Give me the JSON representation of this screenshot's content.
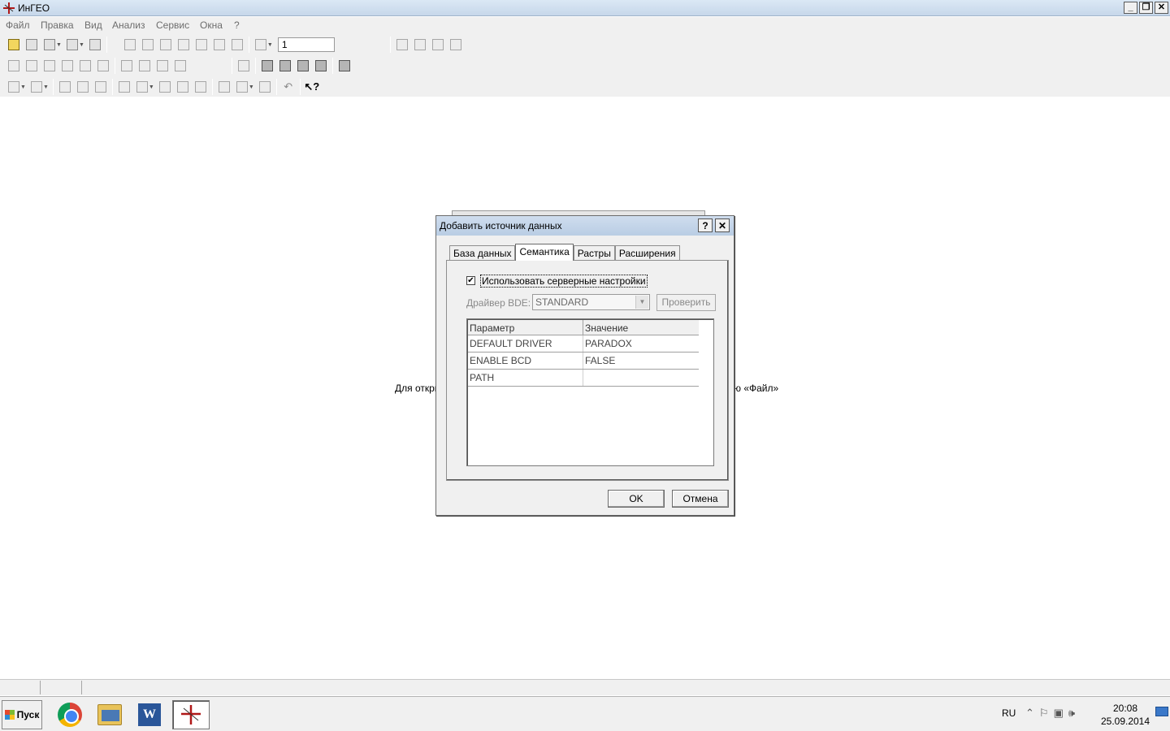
{
  "window": {
    "title": "ИнГЕО"
  },
  "menu": [
    "Файл",
    "Правка",
    "Вид",
    "Анализ",
    "Сервис",
    "Окна",
    "?"
  ],
  "toolbar": {
    "zoom_value": "1"
  },
  "main": {
    "hint_left": "Для откры",
    "hint_right": "ю «Файл»"
  },
  "dialog": {
    "title": "Добавить источник данных",
    "help_label": "?",
    "close_label": "✕",
    "tabs": [
      "База данных",
      "Семантика",
      "Растры",
      "Расширения"
    ],
    "active_tab": "Семантика",
    "use_server_settings": {
      "label": "Использовать серверные настройки",
      "checked": true,
      "mark": "✔"
    },
    "bde_driver": {
      "label": "Драйвер BDE:",
      "value": "STANDARD"
    },
    "check_button": "Проверить",
    "grid": {
      "headers": [
        "Параметр",
        "Значение"
      ],
      "rows": [
        [
          "DEFAULT DRIVER",
          "PARADOX"
        ],
        [
          "ENABLE BCD",
          "FALSE"
        ],
        [
          "PATH",
          ""
        ]
      ]
    },
    "ok_label": "OK",
    "cancel_label": "Отмена"
  },
  "taskbar": {
    "start_label": "Пуск",
    "language": "RU",
    "time": "20:08",
    "date": "25.09.2014",
    "apps": [
      "chrome-icon",
      "file-explorer-icon",
      "word-icon",
      "ingeo-icon"
    ]
  }
}
